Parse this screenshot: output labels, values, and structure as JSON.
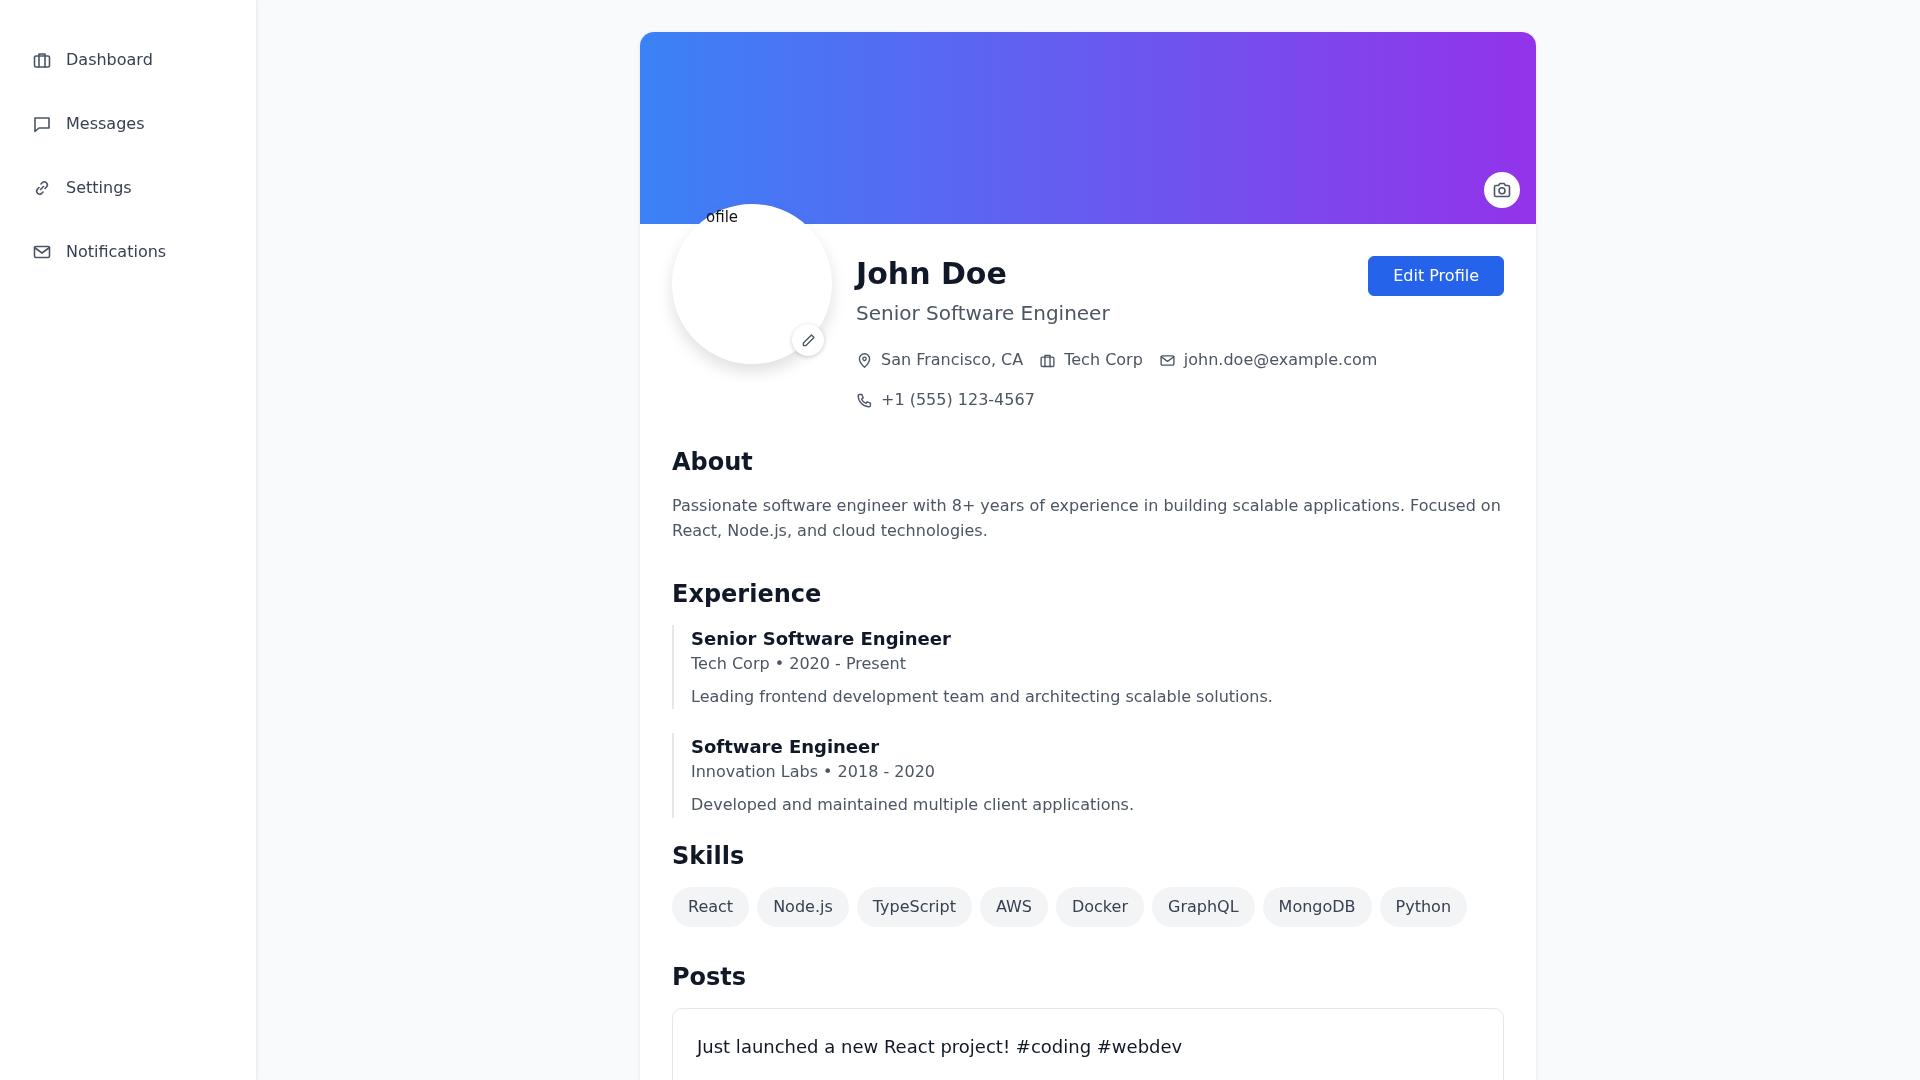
{
  "sidebar": {
    "items": [
      {
        "label": "Dashboard",
        "kind": "briefcase"
      },
      {
        "label": "Messages",
        "kind": "chat"
      },
      {
        "label": "Settings",
        "kind": "link"
      },
      {
        "label": "Notifications",
        "kind": "mail"
      }
    ]
  },
  "profile": {
    "avatar_alt": "ofile",
    "name": "John Doe",
    "title": "Senior Software Engineer",
    "edit_button": "Edit Profile",
    "details": [
      {
        "kind": "location",
        "text": "San Francisco, CA"
      },
      {
        "kind": "company",
        "text": "Tech Corp"
      },
      {
        "kind": "email",
        "text": "john.doe@example.com"
      },
      {
        "kind": "phone",
        "text": "+1 (555) 123-4567"
      }
    ]
  },
  "about": {
    "heading": "About",
    "text": "Passionate software engineer with 8+ years of experience in building scalable applications. Focused on React, Node.js, and cloud technologies."
  },
  "experience": {
    "heading": "Experience",
    "items": [
      {
        "role": "Senior Software Engineer",
        "meta": "Tech Corp • 2020 - Present",
        "description": "Leading frontend development team and architecting scalable solutions."
      },
      {
        "role": "Software Engineer",
        "meta": "Innovation Labs • 2018 - 2020",
        "description": "Developed and maintained multiple client applications."
      }
    ]
  },
  "skills": {
    "heading": "Skills",
    "items": [
      "React",
      "Node.js",
      "TypeScript",
      "AWS",
      "Docker",
      "GraphQL",
      "MongoDB",
      "Python"
    ]
  },
  "posts": {
    "heading": "Posts",
    "items": [
      {
        "text": "Just launched a new React project! #coding #webdev"
      }
    ]
  }
}
